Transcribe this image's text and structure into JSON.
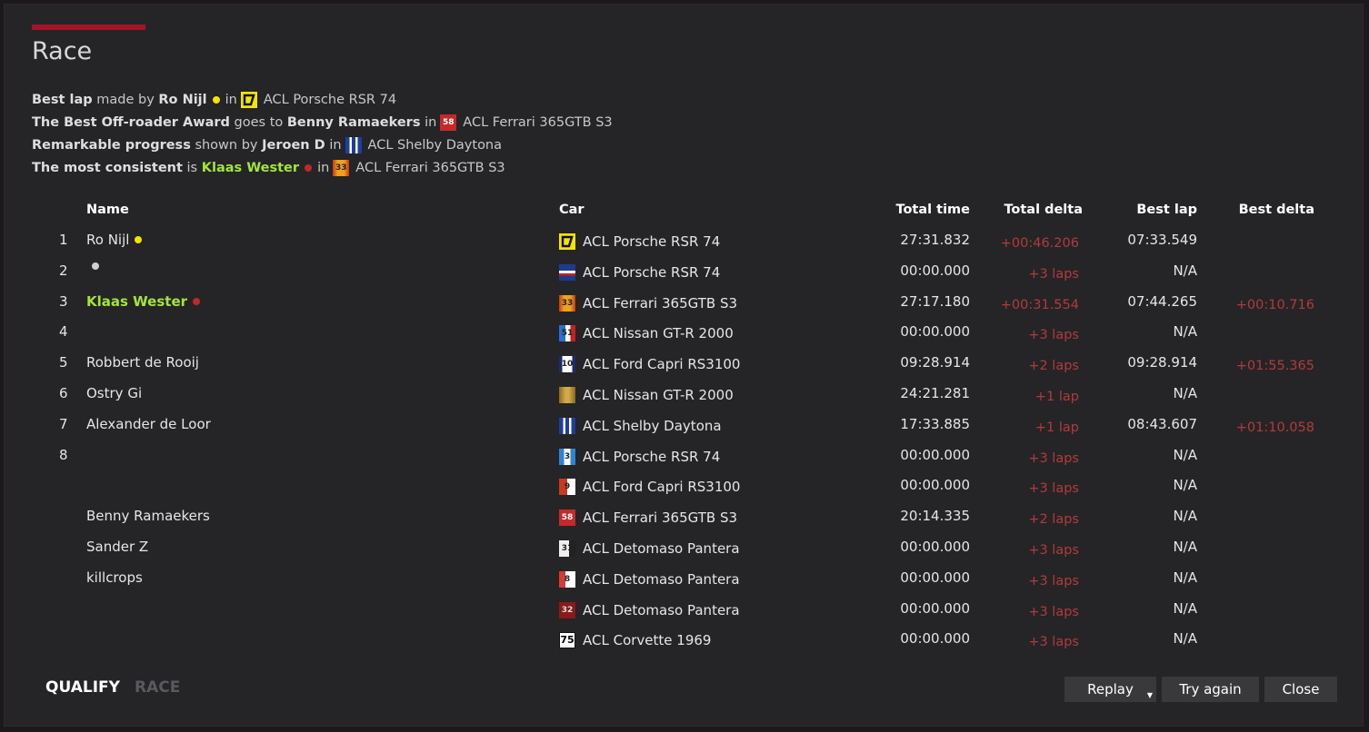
{
  "window": {
    "title": "Race"
  },
  "colors": {
    "accent": "#a31429",
    "highlight": "#a3e635",
    "delta": "#b33a3a"
  },
  "awards": [
    {
      "label": "Best lap",
      "mid": "made by",
      "who": "Ro Nijl",
      "dot": "#f5e400",
      "in": "in",
      "car": "ACL Porsche RSR 74",
      "icon": "yellow-chevron",
      "hl": false
    },
    {
      "label": "The Best Off-roader Award",
      "mid": "goes to",
      "who": "Benny Ramaekers",
      "dot": null,
      "in": "in",
      "car": "ACL Ferrari 365GTB S3",
      "icon": "red-58",
      "hl": false
    },
    {
      "label": "Remarkable progress",
      "mid": "shown by",
      "who": "Jeroen D",
      "dot": null,
      "in": "in",
      "car": "ACL Shelby Daytona",
      "icon": "blue-white-stripes",
      "hl": false
    },
    {
      "label": "The most consistent",
      "mid": "is",
      "who": "Klaas Wester",
      "dot": "#c0282d",
      "in": "in",
      "car": "ACL Ferrari 365GTB S3",
      "icon": "orange-33",
      "hl": true
    }
  ],
  "columns": {
    "name": "Name",
    "car": "Car",
    "total_time": "Total time",
    "total_delta": "Total delta",
    "best_lap": "Best lap",
    "best_delta": "Best delta"
  },
  "rows": [
    {
      "pos": "1",
      "name": "Ro Nijl",
      "dot": "#f5e400",
      "hl": false,
      "car": "ACL Porsche RSR 74",
      "icon": "yellow-chevron",
      "total_time": "27:31.832",
      "total_delta": "+00:46.206",
      "best_lap": "07:33.549",
      "best_delta": ""
    },
    {
      "pos": "2",
      "name": "",
      "dot": "#cfcfcf",
      "hl": false,
      "car": "ACL Porsche RSR 74",
      "icon": "blue-red-martini",
      "total_time": "00:00.000",
      "total_delta": "+3 laps",
      "best_lap": "N/A",
      "best_delta": ""
    },
    {
      "pos": "3",
      "name": "Klaas Wester",
      "dot": "#c0282d",
      "hl": true,
      "car": "ACL Ferrari 365GTB S3",
      "icon": "orange-33",
      "total_time": "27:17.180",
      "total_delta": "+00:31.554",
      "best_lap": "07:44.265",
      "best_delta": "+00:10.716"
    },
    {
      "pos": "4",
      "name": "",
      "dot": null,
      "hl": false,
      "car": "ACL Nissan GT-R 2000",
      "icon": "blue-red-51",
      "total_time": "00:00.000",
      "total_delta": "+3 laps",
      "best_lap": "N/A",
      "best_delta": ""
    },
    {
      "pos": "5",
      "name": "Robbert de Rooij",
      "dot": null,
      "hl": false,
      "car": "ACL Ford Capri RS3100",
      "icon": "white-blue-10",
      "total_time": "09:28.914",
      "total_delta": "+2 laps",
      "best_lap": "09:28.914",
      "best_delta": "+01:55.365"
    },
    {
      "pos": "6",
      "name": "Ostry Gi",
      "dot": null,
      "hl": false,
      "car": "ACL Nissan GT-R 2000",
      "icon": "gold-striped",
      "total_time": "24:21.281",
      "total_delta": "+1 lap",
      "best_lap": "N/A",
      "best_delta": ""
    },
    {
      "pos": "7",
      "name": "Alexander de Loor",
      "dot": null,
      "hl": false,
      "car": "ACL Shelby Daytona",
      "icon": "blue-white-stripes",
      "total_time": "17:33.885",
      "total_delta": "+1 lap",
      "best_lap": "08:43.607",
      "best_delta": "+01:10.058"
    },
    {
      "pos": "8",
      "name": "",
      "dot": null,
      "hl": false,
      "car": "ACL Porsche RSR 74",
      "icon": "blue-3",
      "total_time": "00:00.000",
      "total_delta": "+3 laps",
      "best_lap": "N/A",
      "best_delta": ""
    },
    {
      "pos": "",
      "name": "",
      "dot": null,
      "hl": false,
      "car": "ACL Ford Capri RS3100",
      "icon": "red-white-9",
      "total_time": "00:00.000",
      "total_delta": "+3 laps",
      "best_lap": "N/A",
      "best_delta": ""
    },
    {
      "pos": "",
      "name": "Benny Ramaekers",
      "dot": null,
      "hl": false,
      "car": "ACL Ferrari 365GTB S3",
      "icon": "red-58",
      "total_time": "20:14.335",
      "total_delta": "+2 laps",
      "best_lap": "N/A",
      "best_delta": ""
    },
    {
      "pos": "",
      "name": "Sander Z",
      "dot": null,
      "hl": false,
      "car": "ACL Detomaso Pantera",
      "icon": "white-black-31",
      "total_time": "00:00.000",
      "total_delta": "+3 laps",
      "best_lap": "N/A",
      "best_delta": ""
    },
    {
      "pos": "",
      "name": "killcrops",
      "dot": null,
      "hl": false,
      "car": "ACL Detomaso Pantera",
      "icon": "red-white-8",
      "total_time": "00:00.000",
      "total_delta": "+3 laps",
      "best_lap": "N/A",
      "best_delta": ""
    },
    {
      "pos": "",
      "name": "",
      "dot": null,
      "hl": false,
      "car": "ACL Detomaso Pantera",
      "icon": "darkred-32",
      "total_time": "00:00.000",
      "total_delta": "+3 laps",
      "best_lap": "N/A",
      "best_delta": ""
    },
    {
      "pos": "",
      "name": "",
      "dot": null,
      "hl": false,
      "car": "ACL Corvette 1969",
      "icon": "white-black-75",
      "total_time": "00:00.000",
      "total_delta": "+3 laps",
      "best_lap": "N/A",
      "best_delta": ""
    }
  ],
  "tabs": [
    {
      "label": "QUALIFY",
      "active": true
    },
    {
      "label": "RACE",
      "active": false
    }
  ],
  "buttons": {
    "replay": "Replay",
    "try_again": "Try again",
    "close": "Close"
  }
}
